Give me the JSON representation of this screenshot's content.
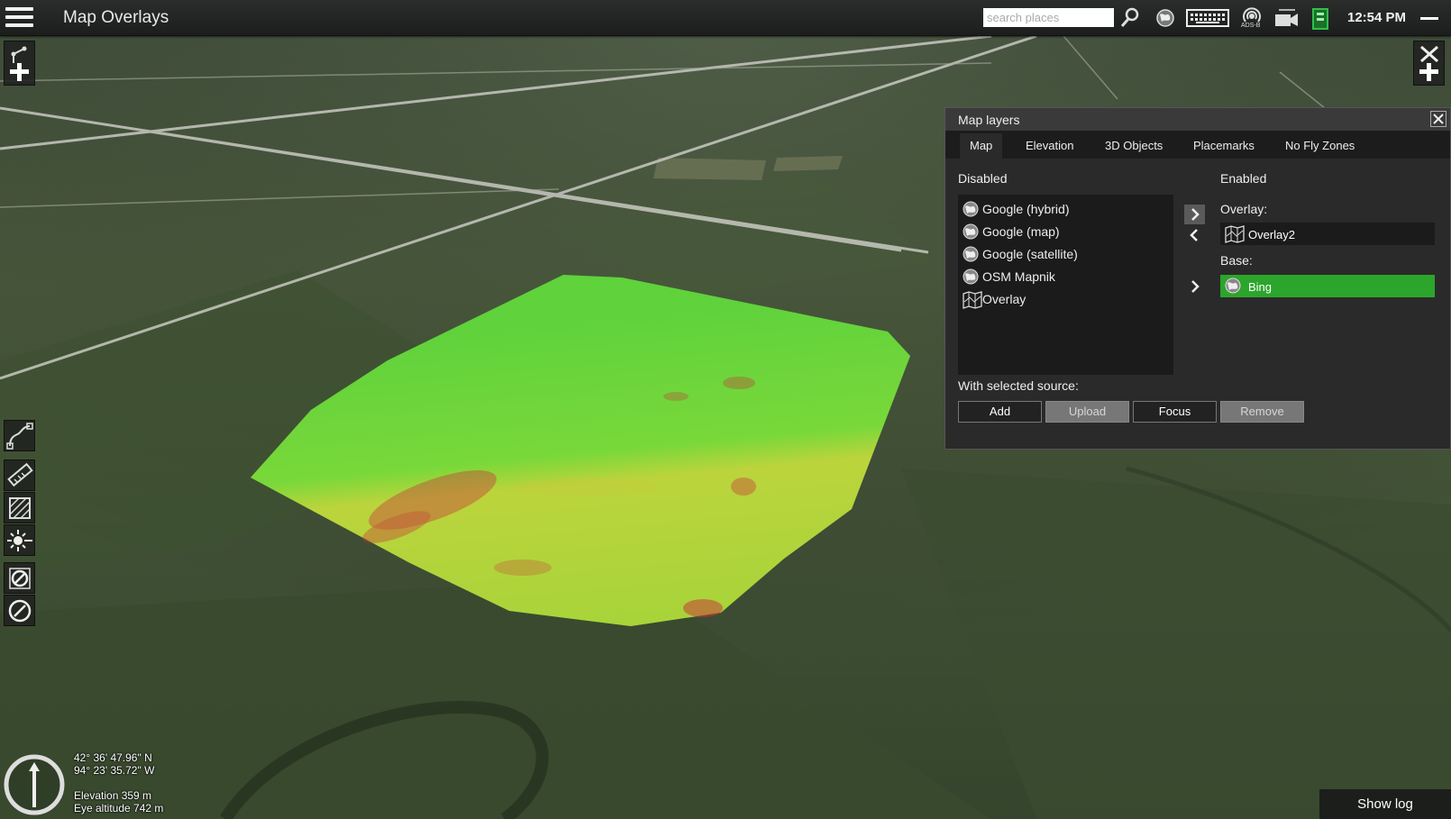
{
  "app": {
    "title": "Map Overlays",
    "clock": "12:54 PM"
  },
  "search": {
    "placeholder": "search places",
    "value": ""
  },
  "toolbar_icons": [
    "search-icon",
    "globe-icon",
    "keyboard-icon",
    "ads-b-icon",
    "camera-icon",
    "battery-icon"
  ],
  "toolbar_labels": {
    "adsb": "ADS-B"
  },
  "panel": {
    "title": "Map layers",
    "tabs": [
      {
        "label": "Map",
        "active": true
      },
      {
        "label": "Elevation",
        "active": false
      },
      {
        "label": "3D Objects",
        "active": false
      },
      {
        "label": "Placemarks",
        "active": false
      },
      {
        "label": "No Fly Zones",
        "active": false
      }
    ],
    "disabled_label": "Disabled",
    "enabled_label": "Enabled",
    "disabled_items": [
      {
        "label": "Google (hybrid)",
        "icon": "globe-icon"
      },
      {
        "label": "Google (map)",
        "icon": "globe-icon"
      },
      {
        "label": "Google (satellite)",
        "icon": "globe-icon"
      },
      {
        "label": "OSM Mapnik",
        "icon": "globe-icon"
      },
      {
        "label": "Overlay",
        "icon": "map-icon"
      }
    ],
    "overlay_label": "Overlay:",
    "overlay_item": {
      "label": "Overlay2",
      "icon": "map-icon"
    },
    "base_label": "Base:",
    "base_item": {
      "label": "Bing",
      "icon": "globe-icon"
    },
    "selected_source_label": "With selected source:",
    "buttons": {
      "add": "Add",
      "upload": "Upload",
      "focus": "Focus",
      "remove": "Remove"
    }
  },
  "location": {
    "latitude": "42° 36' 47.96\" N",
    "longitude": "94° 23' 35.72\" W",
    "elevation": "Elevation 359 m",
    "eye_altitude": "Eye altitude 742 m"
  },
  "footer": {
    "show_log": "Show log"
  },
  "colors": {
    "enabled_highlight": "#2ba52b",
    "overlay_green": "#6ad43a",
    "overlay_yellow": "#c7d63a",
    "overlay_red": "#c8343a"
  }
}
